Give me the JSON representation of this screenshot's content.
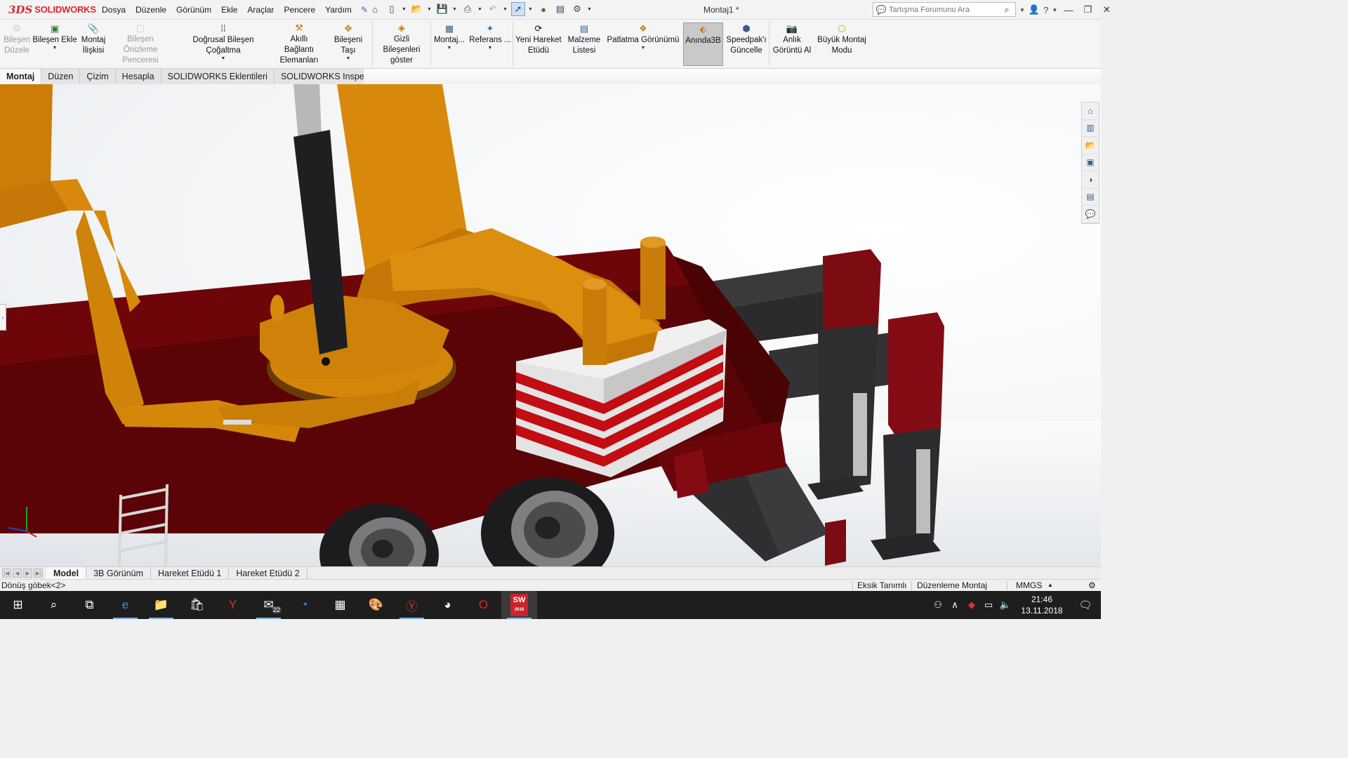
{
  "app": {
    "logo_mark": "3DS",
    "logo_text": "SOLIDWORKS",
    "document_title": "Montaj1 *"
  },
  "menu": [
    "Dosya",
    "Düzenle",
    "Görünüm",
    "Ekle",
    "Araçlar",
    "Pencere",
    "Yardım"
  ],
  "search": {
    "placeholder": "Tartışma Forumunu Ara"
  },
  "ribbon": {
    "component_edit": "Bileşen Düzele",
    "insert_component": "Bileşen Ekle",
    "mate": "Montaj İlişkisi",
    "component_preview": "Bileşen Önizleme Penceresi",
    "linear_pattern": "Doğrusal Bileşen Çoğaltma",
    "smart_fasteners": "Akıllı Bağlantı Elemanları",
    "move_component": "Bileşeni Taşı",
    "show_hidden": "Gizli Bileşenleri göster",
    "assembly": "Montaj...",
    "reference": "Referans ...",
    "new_motion": "Yeni Hareket Etüdü",
    "bom": "Malzeme Listesi",
    "exploded_view": "Patlatma Görünümü",
    "instant3d": "Anında3B",
    "speedpak": "Speedpak'ı Güncelle",
    "snapshot": "Anlık Görüntü Al",
    "large_assembly": "Büyük Montaj Modu"
  },
  "tabs": [
    "Montaj",
    "Düzen",
    "Çizim",
    "Hesapla",
    "SOLIDWORKS Eklentileri",
    "SOLIDWORKS Inspection"
  ],
  "bottom_tabs": [
    "Model",
    "3B Görünüm",
    "Hareket Etüdü 1",
    "Hareket Etüdü 2"
  ],
  "status": {
    "left": "Dönüş göbek<2>",
    "definition": "Eksik Tanımlı",
    "mode": "Düzenleme Montaj",
    "units": "MMGS"
  },
  "taskbar": {
    "mail_badge": "22",
    "sw_label": "SW",
    "sw_version": "2018",
    "time": "21:46",
    "date": "13.11.2018"
  }
}
